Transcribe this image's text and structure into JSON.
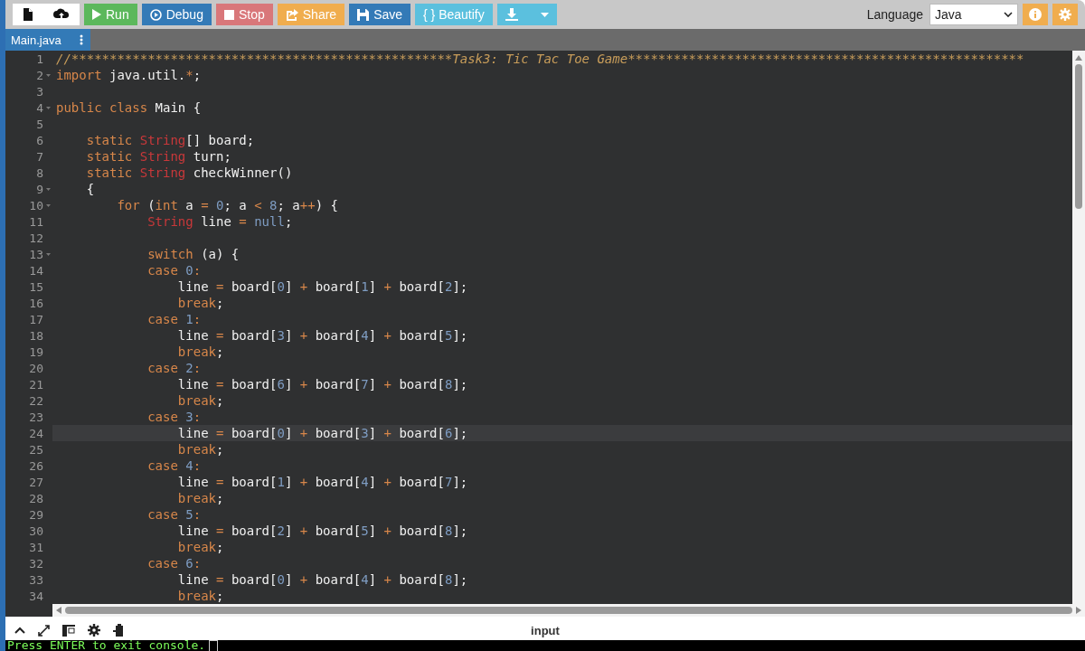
{
  "toolbar": {
    "buttons": [
      {
        "kind": "new-file",
        "color": "#ffffff"
      },
      {
        "kind": "upload",
        "color": "#ffffff"
      },
      {
        "kind": "run",
        "label": "Run",
        "color": "#5cb85c"
      },
      {
        "kind": "debug",
        "label": "Debug",
        "color": "#337ab7"
      },
      {
        "kind": "stop",
        "label": "Stop",
        "color": "#d9777a"
      },
      {
        "kind": "share",
        "label": "Share",
        "color": "#f0ad4e"
      },
      {
        "kind": "save",
        "label": "Save",
        "color": "#337ab7"
      },
      {
        "kind": "beautify",
        "label": "{ } Beautify",
        "color": "#5bc0de"
      },
      {
        "kind": "download",
        "color": "#5bc0de"
      }
    ],
    "language_label": "Language",
    "language_value": "Java"
  },
  "tabs": [
    {
      "label": "Main.java",
      "selected": true
    }
  ],
  "editor": {
    "lines": [
      {
        "number": "1",
        "foldable": false,
        "active": false,
        "tokens": [
          {
            "kind": "comment",
            "text": "//**************************************************Task3: Tic Tac Toe Game****************************************************"
          }
        ]
      },
      {
        "number": "2",
        "foldable": true,
        "active": false,
        "tokens": [
          {
            "kind": "keyword",
            "text": "import"
          },
          {
            "kind": "plain",
            "text": " java.util."
          },
          {
            "kind": "operator",
            "text": "*"
          },
          {
            "kind": "plain",
            "text": ";"
          }
        ]
      },
      {
        "number": "3",
        "foldable": false,
        "active": false
      },
      {
        "number": "4",
        "foldable": true,
        "active": false,
        "tokens": [
          {
            "kind": "keyword",
            "text": "public class"
          },
          {
            "kind": "plain",
            "text": " Main {"
          }
        ]
      },
      {
        "number": "5",
        "foldable": false,
        "active": false
      },
      {
        "number": "6",
        "foldable": false,
        "active": false,
        "tokens": [
          {
            "kind": "keyword",
            "text": "    static"
          },
          {
            "kind": "type",
            "text": " String"
          },
          {
            "kind": "plain",
            "text": "[] board;"
          }
        ]
      },
      {
        "number": "7",
        "foldable": false,
        "active": false,
        "tokens": [
          {
            "kind": "keyword",
            "text": "    static"
          },
          {
            "kind": "type",
            "text": " String"
          },
          {
            "kind": "plain",
            "text": " turn;"
          }
        ]
      },
      {
        "number": "8",
        "foldable": false,
        "active": false,
        "tokens": [
          {
            "kind": "keyword",
            "text": "    static"
          },
          {
            "kind": "type",
            "text": " String"
          },
          {
            "kind": "plain",
            "text": " checkWinner()"
          }
        ]
      },
      {
        "number": "9",
        "foldable": true,
        "active": false,
        "tokens": [
          {
            "kind": "plain",
            "text": "    {"
          }
        ]
      },
      {
        "number": "10",
        "foldable": true,
        "active": false,
        "tokens": [
          {
            "kind": "keyword",
            "text": "        for"
          },
          {
            "kind": "plain",
            "text": " ("
          },
          {
            "kind": "keyword",
            "text": "int"
          },
          {
            "kind": "plain",
            "text": " a "
          },
          {
            "kind": "operator",
            "text": "="
          },
          {
            "kind": "number",
            "text": " 0"
          },
          {
            "kind": "plain",
            "text": "; a "
          },
          {
            "kind": "operator",
            "text": "<"
          },
          {
            "kind": "number",
            "text": " 8"
          },
          {
            "kind": "plain",
            "text": "; a"
          },
          {
            "kind": "operator",
            "text": "++"
          },
          {
            "kind": "plain",
            "text": ") {"
          }
        ]
      },
      {
        "number": "11",
        "foldable": false,
        "active": false,
        "tokens": [
          {
            "kind": "type",
            "text": "            String"
          },
          {
            "kind": "plain",
            "text": " line "
          },
          {
            "kind": "operator",
            "text": "="
          },
          {
            "kind": "number",
            "text": " null"
          },
          {
            "kind": "plain",
            "text": ";"
          }
        ]
      },
      {
        "number": "12",
        "foldable": false,
        "active": false
      },
      {
        "number": "13",
        "foldable": true,
        "active": false,
        "tokens": [
          {
            "kind": "keyword",
            "text": "            switch"
          },
          {
            "kind": "plain",
            "text": " (a) {"
          }
        ]
      },
      {
        "number": "14",
        "foldable": false,
        "active": false,
        "tokens": [
          {
            "kind": "keyword",
            "text": "            case"
          },
          {
            "kind": "number",
            "text": " 0"
          },
          {
            "kind": "operator",
            "text": ":"
          }
        ]
      },
      {
        "number": "15",
        "foldable": false,
        "active": false,
        "tokens": [
          {
            "kind": "plain",
            "text": "                line "
          },
          {
            "kind": "operator",
            "text": "="
          },
          {
            "kind": "plain",
            "text": " board["
          },
          {
            "kind": "number",
            "text": "0"
          },
          {
            "kind": "plain",
            "text": "] "
          },
          {
            "kind": "operator",
            "text": "+"
          },
          {
            "kind": "plain",
            "text": " board["
          },
          {
            "kind": "number",
            "text": "1"
          },
          {
            "kind": "plain",
            "text": "] "
          },
          {
            "kind": "operator",
            "text": "+"
          },
          {
            "kind": "plain",
            "text": " board["
          },
          {
            "kind": "number",
            "text": "2"
          },
          {
            "kind": "plain",
            "text": "];"
          }
        ]
      },
      {
        "number": "16",
        "foldable": false,
        "active": false,
        "tokens": [
          {
            "kind": "keyword",
            "text": "                break"
          },
          {
            "kind": "plain",
            "text": ";"
          }
        ]
      },
      {
        "number": "17",
        "foldable": false,
        "active": false,
        "tokens": [
          {
            "kind": "keyword",
            "text": "            case"
          },
          {
            "kind": "number",
            "text": " 1"
          },
          {
            "kind": "operator",
            "text": ":"
          }
        ]
      },
      {
        "number": "18",
        "foldable": false,
        "active": false,
        "tokens": [
          {
            "kind": "plain",
            "text": "                line "
          },
          {
            "kind": "operator",
            "text": "="
          },
          {
            "kind": "plain",
            "text": " board["
          },
          {
            "kind": "number",
            "text": "3"
          },
          {
            "kind": "plain",
            "text": "] "
          },
          {
            "kind": "operator",
            "text": "+"
          },
          {
            "kind": "plain",
            "text": " board["
          },
          {
            "kind": "number",
            "text": "4"
          },
          {
            "kind": "plain",
            "text": "] "
          },
          {
            "kind": "operator",
            "text": "+"
          },
          {
            "kind": "plain",
            "text": " board["
          },
          {
            "kind": "number",
            "text": "5"
          },
          {
            "kind": "plain",
            "text": "];"
          }
        ]
      },
      {
        "number": "19",
        "foldable": false,
        "active": false,
        "tokens": [
          {
            "kind": "keyword",
            "text": "                break"
          },
          {
            "kind": "plain",
            "text": ";"
          }
        ]
      },
      {
        "number": "20",
        "foldable": false,
        "active": false,
        "tokens": [
          {
            "kind": "keyword",
            "text": "            case"
          },
          {
            "kind": "number",
            "text": " 2"
          },
          {
            "kind": "operator",
            "text": ":"
          }
        ]
      },
      {
        "number": "21",
        "foldable": false,
        "active": false,
        "tokens": [
          {
            "kind": "plain",
            "text": "                line "
          },
          {
            "kind": "operator",
            "text": "="
          },
          {
            "kind": "plain",
            "text": " board["
          },
          {
            "kind": "number",
            "text": "6"
          },
          {
            "kind": "plain",
            "text": "] "
          },
          {
            "kind": "operator",
            "text": "+"
          },
          {
            "kind": "plain",
            "text": " board["
          },
          {
            "kind": "number",
            "text": "7"
          },
          {
            "kind": "plain",
            "text": "] "
          },
          {
            "kind": "operator",
            "text": "+"
          },
          {
            "kind": "plain",
            "text": " board["
          },
          {
            "kind": "number",
            "text": "8"
          },
          {
            "kind": "plain",
            "text": "];"
          }
        ]
      },
      {
        "number": "22",
        "foldable": false,
        "active": false,
        "tokens": [
          {
            "kind": "keyword",
            "text": "                break"
          },
          {
            "kind": "plain",
            "text": ";"
          }
        ]
      },
      {
        "number": "23",
        "foldable": false,
        "active": false,
        "tokens": [
          {
            "kind": "keyword",
            "text": "            case"
          },
          {
            "kind": "number",
            "text": " 3"
          },
          {
            "kind": "operator",
            "text": ":"
          }
        ]
      },
      {
        "number": "24",
        "foldable": false,
        "active": true,
        "tokens": [
          {
            "kind": "plain",
            "text": "                line "
          },
          {
            "kind": "operator",
            "text": "="
          },
          {
            "kind": "plain",
            "text": " board["
          },
          {
            "kind": "number",
            "text": "0"
          },
          {
            "kind": "plain",
            "text": "] "
          },
          {
            "kind": "operator",
            "text": "+"
          },
          {
            "kind": "plain",
            "text": " board["
          },
          {
            "kind": "number",
            "text": "3"
          },
          {
            "kind": "plain",
            "text": "] "
          },
          {
            "kind": "operator",
            "text": "+"
          },
          {
            "kind": "plain",
            "text": " board["
          },
          {
            "kind": "number",
            "text": "6"
          },
          {
            "kind": "plain",
            "text": "];"
          }
        ]
      },
      {
        "number": "25",
        "foldable": false,
        "active": false,
        "tokens": [
          {
            "kind": "keyword",
            "text": "                break"
          },
          {
            "kind": "plain",
            "text": ";"
          }
        ]
      },
      {
        "number": "26",
        "foldable": false,
        "active": false,
        "tokens": [
          {
            "kind": "keyword",
            "text": "            case"
          },
          {
            "kind": "number",
            "text": " 4"
          },
          {
            "kind": "operator",
            "text": ":"
          }
        ]
      },
      {
        "number": "27",
        "foldable": false,
        "active": false,
        "tokens": [
          {
            "kind": "plain",
            "text": "                line "
          },
          {
            "kind": "operator",
            "text": "="
          },
          {
            "kind": "plain",
            "text": " board["
          },
          {
            "kind": "number",
            "text": "1"
          },
          {
            "kind": "plain",
            "text": "] "
          },
          {
            "kind": "operator",
            "text": "+"
          },
          {
            "kind": "plain",
            "text": " board["
          },
          {
            "kind": "number",
            "text": "4"
          },
          {
            "kind": "plain",
            "text": "] "
          },
          {
            "kind": "operator",
            "text": "+"
          },
          {
            "kind": "plain",
            "text": " board["
          },
          {
            "kind": "number",
            "text": "7"
          },
          {
            "kind": "plain",
            "text": "];"
          }
        ]
      },
      {
        "number": "28",
        "foldable": false,
        "active": false,
        "tokens": [
          {
            "kind": "keyword",
            "text": "                break"
          },
          {
            "kind": "plain",
            "text": ";"
          }
        ]
      },
      {
        "number": "29",
        "foldable": false,
        "active": false,
        "tokens": [
          {
            "kind": "keyword",
            "text": "            case"
          },
          {
            "kind": "number",
            "text": " 5"
          },
          {
            "kind": "operator",
            "text": ":"
          }
        ]
      },
      {
        "number": "30",
        "foldable": false,
        "active": false,
        "tokens": [
          {
            "kind": "plain",
            "text": "                line "
          },
          {
            "kind": "operator",
            "text": "="
          },
          {
            "kind": "plain",
            "text": " board["
          },
          {
            "kind": "number",
            "text": "2"
          },
          {
            "kind": "plain",
            "text": "] "
          },
          {
            "kind": "operator",
            "text": "+"
          },
          {
            "kind": "plain",
            "text": " board["
          },
          {
            "kind": "number",
            "text": "5"
          },
          {
            "kind": "plain",
            "text": "] "
          },
          {
            "kind": "operator",
            "text": "+"
          },
          {
            "kind": "plain",
            "text": " board["
          },
          {
            "kind": "number",
            "text": "8"
          },
          {
            "kind": "plain",
            "text": "];"
          }
        ]
      },
      {
        "number": "31",
        "foldable": false,
        "active": false,
        "tokens": [
          {
            "kind": "keyword",
            "text": "                break"
          },
          {
            "kind": "plain",
            "text": ";"
          }
        ]
      },
      {
        "number": "32",
        "foldable": false,
        "active": false,
        "tokens": [
          {
            "kind": "keyword",
            "text": "            case"
          },
          {
            "kind": "number",
            "text": " 6"
          },
          {
            "kind": "operator",
            "text": ":"
          }
        ]
      },
      {
        "number": "33",
        "foldable": false,
        "active": false,
        "tokens": [
          {
            "kind": "plain",
            "text": "                line "
          },
          {
            "kind": "operator",
            "text": "="
          },
          {
            "kind": "plain",
            "text": " board["
          },
          {
            "kind": "number",
            "text": "0"
          },
          {
            "kind": "plain",
            "text": "] "
          },
          {
            "kind": "operator",
            "text": "+"
          },
          {
            "kind": "plain",
            "text": " board["
          },
          {
            "kind": "number",
            "text": "4"
          },
          {
            "kind": "plain",
            "text": "] "
          },
          {
            "kind": "operator",
            "text": "+"
          },
          {
            "kind": "plain",
            "text": " board["
          },
          {
            "kind": "number",
            "text": "8"
          },
          {
            "kind": "plain",
            "text": "];"
          }
        ]
      },
      {
        "number": "34",
        "foldable": false,
        "active": false,
        "tokens": [
          {
            "kind": "keyword",
            "text": "                break"
          },
          {
            "kind": "plain",
            "text": ";"
          }
        ]
      }
    ]
  },
  "console": {
    "title": "input",
    "output": "Press ENTER to exit console."
  }
}
